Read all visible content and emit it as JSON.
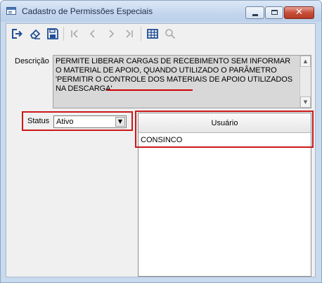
{
  "window": {
    "title": "Cadastro de Permissões Especiais",
    "controls": {
      "minimize": "minimize-icon",
      "maximize": "maximize-icon",
      "close": "close-icon"
    }
  },
  "toolbar": {
    "buttons": [
      {
        "name": "exit-icon",
        "enabled": true
      },
      {
        "name": "eraser-icon",
        "enabled": true
      },
      {
        "name": "save-icon",
        "enabled": true
      },
      {
        "name": "first-record-icon",
        "enabled": false
      },
      {
        "name": "previous-record-icon",
        "enabled": false
      },
      {
        "name": "next-record-icon",
        "enabled": false
      },
      {
        "name": "last-record-icon",
        "enabled": false
      },
      {
        "name": "table-view-icon",
        "enabled": true
      },
      {
        "name": "search-icon",
        "enabled": false
      }
    ]
  },
  "form": {
    "description_label": "Descrição",
    "description_value": "PERMITE LIBERAR CARGAS DE RECEBIMENTO SEM INFORMAR O MATERIAL DE APOIO, QUANDO UTILIZADO O PARÂMETRO 'PERMITIR O CONTROLE DOS MATERIAIS DE APOIO UTILIZADOS NA DESCARGA'",
    "status_label": "Status",
    "status_value": "Ativo"
  },
  "grid": {
    "columns": [
      "Usuário"
    ],
    "rows": [
      [
        "CONSINCO"
      ]
    ]
  },
  "colors": {
    "highlight_border": "#cc1818",
    "title_bar": "#c4d6ee"
  }
}
